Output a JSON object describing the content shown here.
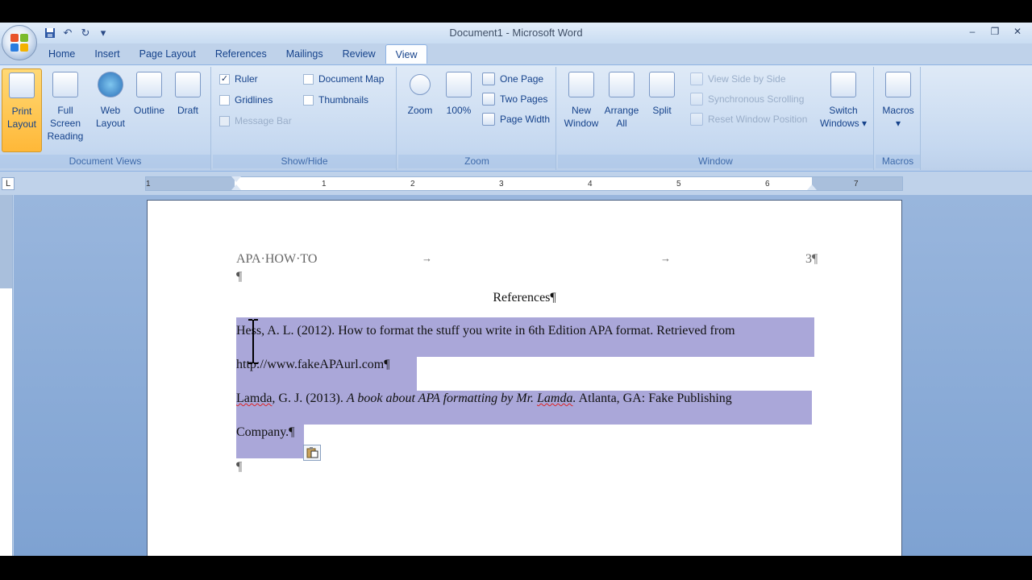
{
  "window": {
    "title": "Document1 - Microsoft Word",
    "controls": [
      "–",
      "❐",
      "✕"
    ]
  },
  "quick_access": [
    "save-icon",
    "undo-icon",
    "redo-icon",
    "customize-icon"
  ],
  "tabs": [
    {
      "label": "Home"
    },
    {
      "label": "Insert"
    },
    {
      "label": "Page Layout"
    },
    {
      "label": "References"
    },
    {
      "label": "Mailings"
    },
    {
      "label": "Review"
    },
    {
      "label": "View",
      "active": true
    }
  ],
  "ribbon": {
    "document_views": {
      "label": "Document Views",
      "buttons": [
        {
          "line1": "Print",
          "line2": "Layout",
          "selected": true
        },
        {
          "line1": "Full Screen",
          "line2": "Reading"
        },
        {
          "line1": "Web",
          "line2": "Layout"
        },
        {
          "line1": "Outline",
          "line2": ""
        },
        {
          "line1": "Draft",
          "line2": ""
        }
      ]
    },
    "show_hide": {
      "label": "Show/Hide",
      "items": [
        {
          "label": "Ruler",
          "checked": true,
          "enabled": true
        },
        {
          "label": "Gridlines",
          "checked": false,
          "enabled": true
        },
        {
          "label": "Message Bar",
          "checked": false,
          "enabled": false
        },
        {
          "label": "Document Map",
          "checked": false,
          "enabled": true
        },
        {
          "label": "Thumbnails",
          "checked": false,
          "enabled": true
        }
      ]
    },
    "zoom": {
      "label": "Zoom",
      "zoom_button": "Zoom",
      "hundred_button": "100%",
      "one_page": "One Page",
      "two_pages": "Two Pages",
      "page_width": "Page Width"
    },
    "window_group": {
      "label": "Window",
      "new_window": {
        "line1": "New",
        "line2": "Window"
      },
      "arrange_all": {
        "line1": "Arrange",
        "line2": "All"
      },
      "split": "Split",
      "view_side_by_side": "View Side by Side",
      "sync_scrolling": "Synchronous Scrolling",
      "reset_window": "Reset Window Position",
      "switch_windows": {
        "line1": "Switch",
        "line2": "Windows ▾"
      }
    },
    "macros": {
      "label": "Macros",
      "button": "Macros",
      "arrow": "▾"
    }
  },
  "ruler": {
    "corner": "L",
    "numbers": [
      "1",
      "1",
      "2",
      "3",
      "4",
      "5",
      "6",
      "7"
    ]
  },
  "document": {
    "header_left": "APA·HOW·TO",
    "header_right": "3¶",
    "tab_arrow": "→",
    "pilcrow": "¶",
    "title": "References¶",
    "ref1_line1": "Hess, A. L. (2012). How to format the stuff you write in 6th Edition APA format. Retrieved from",
    "ref1_line2": "http://www.fakeAPAurl.com¶",
    "ref2_line1_a": "Lamda",
    "ref2_line1_b": ", G. J. (2013). ",
    "ref2_line1_c": "A book about APA formatting by Mr. ",
    "ref2_line1_d": "Lamda",
    "ref2_line1_e": ".",
    "ref2_line1_f": " Atlanta, GA: Fake Publishing",
    "ref2_line2": "Company.¶",
    "end_pilcrow": "¶",
    "paste_icon": "clipboard-icon"
  }
}
